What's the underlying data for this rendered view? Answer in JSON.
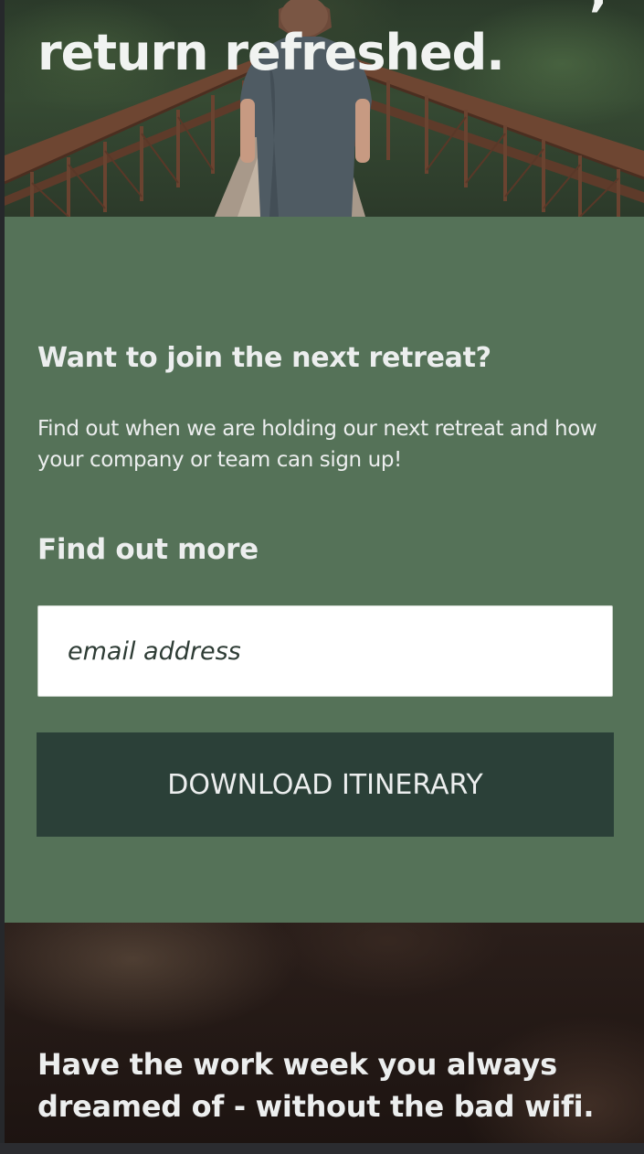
{
  "hero": {
    "title": "return refreshed.",
    "title_tail": ","
  },
  "signup": {
    "heading": "Want to join the next retreat?",
    "description": "Find out when we are holding our next retreat and how your company or team can sign up!",
    "find_out_heading": "Find out more",
    "email_placeholder": "email address",
    "email_value": "",
    "download_label": "DOWNLOAD ITINERARY"
  },
  "bottom": {
    "title": "Have the work week you always dreamed of - without the bad wifi."
  },
  "colors": {
    "signup_bg": "#557258",
    "button_bg": "#2b4038",
    "text_light": "#eceeee"
  }
}
